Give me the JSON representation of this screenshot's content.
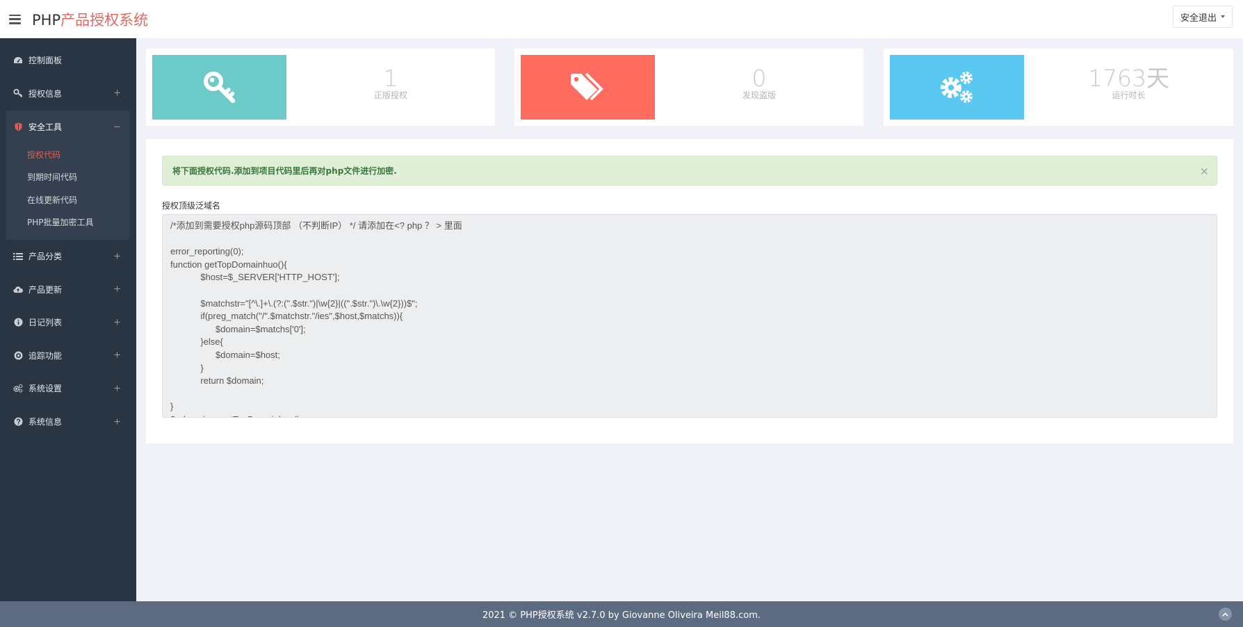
{
  "header": {
    "brand_prefix": "PHP",
    "brand_suffix": "产品授权系统",
    "logout_label": "安全退出"
  },
  "sidebar": {
    "items": [
      {
        "label": "控制面板",
        "icon": "dashboard-icon",
        "sign": ""
      },
      {
        "label": "授权信息",
        "icon": "key-icon",
        "sign": "+"
      },
      {
        "label": "安全工具",
        "icon": "shield-icon",
        "sign": "−"
      },
      {
        "label": "产品分类",
        "icon": "list-icon",
        "sign": "+"
      },
      {
        "label": "产品更新",
        "icon": "cloud-upload-icon",
        "sign": "+"
      },
      {
        "label": "日记列表",
        "icon": "info-circle-icon",
        "sign": "+"
      },
      {
        "label": "追踪功能",
        "icon": "target-icon",
        "sign": "+"
      },
      {
        "label": "系统设置",
        "icon": "gears-icon",
        "sign": "+"
      },
      {
        "label": "系统信息",
        "icon": "question-circle-icon",
        "sign": "+"
      }
    ],
    "sub_items": [
      "授权代码",
      "到期时间代码",
      "在线更新代码",
      "PHP批量加密工具"
    ],
    "active_sub": "授权代码"
  },
  "stats": [
    {
      "value": "1",
      "label": "正版授权",
      "icon": "key-icon",
      "color": "#6ccbc8"
    },
    {
      "value": "0",
      "label": "发现盗版",
      "icon": "tags-icon",
      "color": "#ff6b5e"
    },
    {
      "value": "1763天",
      "label": "运行时长",
      "icon": "gears-icon",
      "color": "#5bc8f2"
    }
  ],
  "alert": {
    "text": "将下面授权代码.添加到项目代码里后再对php文件进行加密.",
    "close": "×"
  },
  "code_panel": {
    "label": "授权顶级泛域名",
    "code": "/*添加到需要授权php源码顶部 （不判断IP） */ 请添加在<? php ？ > 里面\n\nerror_reporting(0);\nfunction getTopDomainhuo(){\n\t\t$host=$_SERVER['HTTP_HOST'];\n\n\t\t$matchstr=\"[^\\.]+\\.(?:(\".$str.\")|\\w{2}|((\".$str.\")\\.\\w{2}))$\";\n\t\tif(preg_match(\"/\".$matchstr.\"/ies\",$host,$matchs)){\n\t\t\t$domain=$matchs['0'];\n\t\t}else{\n\t\t\t$domain=$host;\n\t\t}\n\t\treturn $domain;\n\n}\n$_domain = getTopDomainhuo();"
  },
  "footer": {
    "text": "2021 © PHP授权系统 v2.7.0 by Giovanne Oliveira Meil88.com."
  }
}
